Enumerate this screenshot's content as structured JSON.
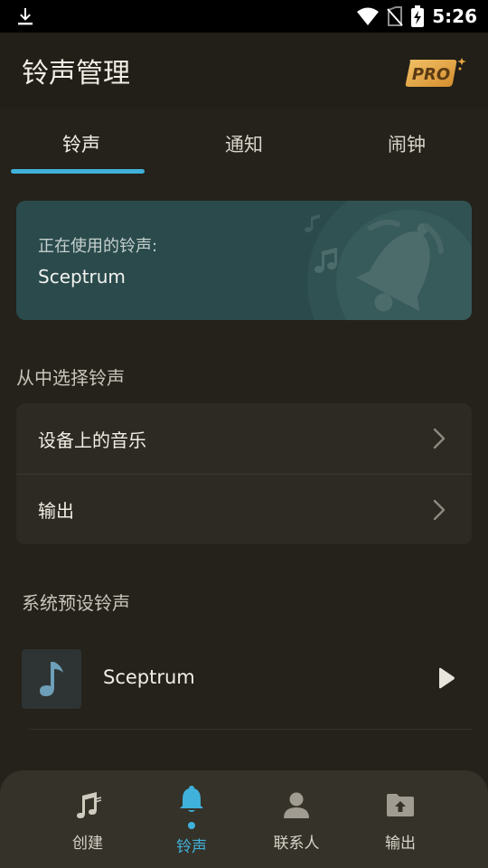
{
  "status_bar": {
    "time": "5:26"
  },
  "app_bar": {
    "title": "铃声管理",
    "pro_label": "PRO"
  },
  "tabs": [
    {
      "label": "铃声",
      "active": true
    },
    {
      "label": "通知",
      "active": false
    },
    {
      "label": "闹钟",
      "active": false
    }
  ],
  "current_ringtone": {
    "label": "正在使用的铃声:",
    "value": "Sceptrum"
  },
  "choose_section": {
    "title": "从中选择铃声",
    "items": [
      {
        "label": "设备上的音乐"
      },
      {
        "label": "输出"
      }
    ]
  },
  "preset_section": {
    "title": "系统预设铃声",
    "items": [
      {
        "name": "Sceptrum"
      }
    ]
  },
  "bottom_nav": [
    {
      "label": "创建",
      "icon": "music-note-icon",
      "active": false
    },
    {
      "label": "铃声",
      "icon": "bell-icon",
      "active": true
    },
    {
      "label": "联系人",
      "icon": "contact-icon",
      "active": false
    },
    {
      "label": "输出",
      "icon": "folder-upload-icon",
      "active": false
    }
  ],
  "colors": {
    "accent": "#3fb1da",
    "background": "#24221b",
    "card_teal": "#2a4a4c",
    "nav_background": "#353229"
  }
}
